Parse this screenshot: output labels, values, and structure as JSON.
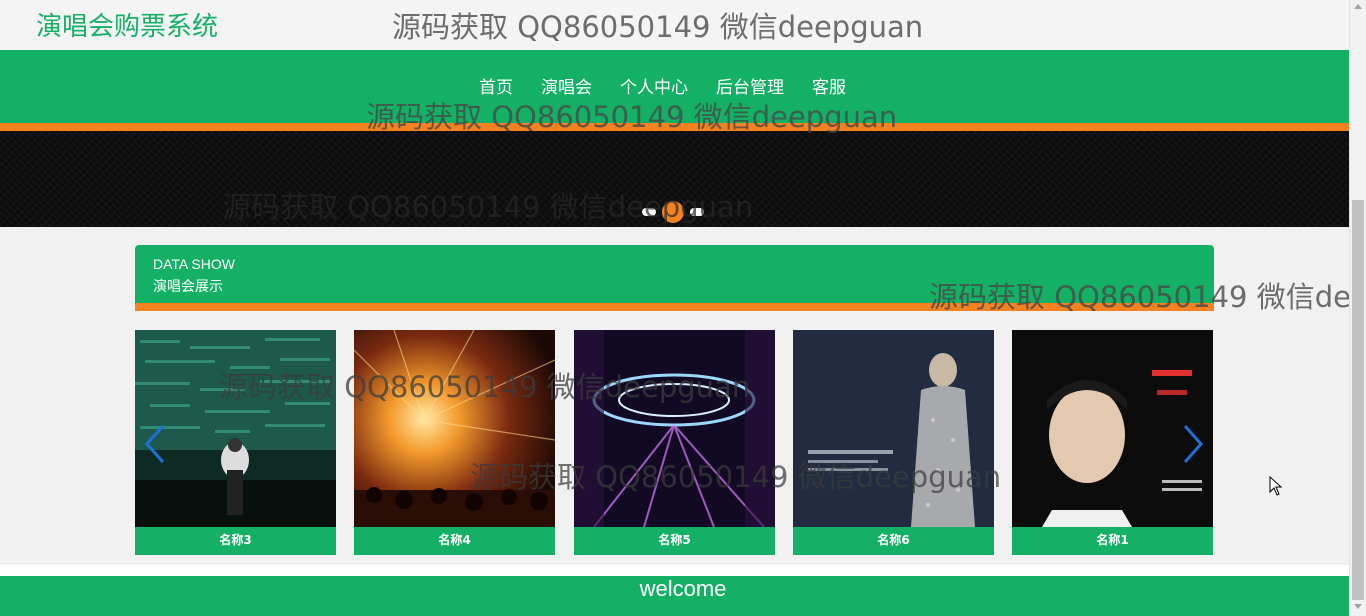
{
  "header": {
    "site_title": "演唱会购票系统"
  },
  "watermark": "源码获取 QQ86050149 微信deepguan",
  "nav": {
    "items": [
      {
        "label": "首页",
        "name": "nav-item-home"
      },
      {
        "label": "演唱会",
        "name": "nav-item-concerts"
      },
      {
        "label": "个人中心",
        "name": "nav-item-profile"
      },
      {
        "label": "后台管理",
        "name": "nav-item-admin"
      },
      {
        "label": "客服",
        "name": "nav-item-service"
      }
    ]
  },
  "carousel": {
    "slide_count": 3,
    "active_index": 1
  },
  "section": {
    "title_en": "DATA SHOW",
    "title_zh": "演唱会展示"
  },
  "cards": [
    {
      "label": "名称3"
    },
    {
      "label": "名称4"
    },
    {
      "label": "名称5"
    },
    {
      "label": "名称6"
    },
    {
      "label": "名称1"
    }
  ],
  "icons": {
    "prev": "chevron-left-icon",
    "next": "chevron-right-icon"
  },
  "footer": {
    "text": "welcome"
  },
  "colors": {
    "brand_green": "#14b066",
    "accent_orange": "#f58220",
    "slider_arrow_blue": "#1e6fd9"
  }
}
